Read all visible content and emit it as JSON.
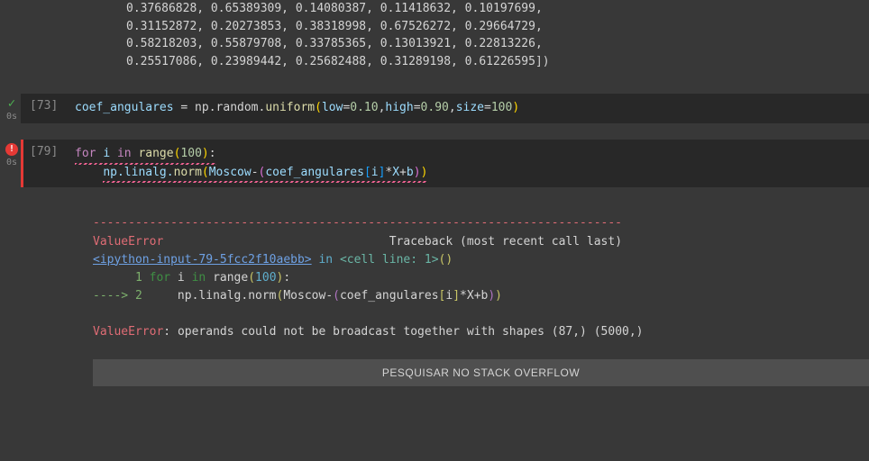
{
  "output_top": {
    "lines": [
      "0.37686828, 0.65389309, 0.14080387, 0.11418632, 0.10197699,",
      "0.31152872, 0.20273853, 0.38318998, 0.67526272, 0.29664729,",
      "0.58218203, 0.55879708, 0.33785365, 0.13013921, 0.22813226,",
      "0.25517086, 0.23989442, 0.25682488, 0.31289198, 0.61226595])"
    ]
  },
  "cell1": {
    "status": "ok",
    "exec_time": "0s",
    "exec_count": "[73]",
    "code": {
      "var": "coef_angulares",
      "assign": " = np.random.",
      "fn": "uniform",
      "p_low": "low",
      "v_low": "0.10",
      "p_high": "high",
      "v_high": "0.90",
      "p_size": "size",
      "v_size": "100"
    }
  },
  "cell2": {
    "status": "error",
    "exec_time": "0s",
    "exec_count": "[79]",
    "code": {
      "kw_for": "for",
      "var_i": "i",
      "kw_in": "in",
      "fn_range": "range",
      "range_arg": "100",
      "obj_np": "np.linalg.",
      "fn_norm": "norm",
      "arr_moscow": "Moscow",
      "arr_coef": "coef_angulares",
      "idx_i": "i",
      "var_x": "X",
      "var_b": "b"
    }
  },
  "traceback": {
    "dashes": "---------------------------------------------------------------------------",
    "err_name": "ValueError",
    "tb_header": "Traceback (most recent call last)",
    "link": "<ipython-input-79-5fcc2f10aebb>",
    "in": " in ",
    "cell_line": "<cell line: 1>",
    "parens": "()",
    "l1_num": "1",
    "l1_code_pre": " ",
    "l1_for": "for",
    "l1_i": " i ",
    "l1_in": "in",
    "l1_range": " range",
    "l1_range_arg": "100",
    "arrow": "----> ",
    "l2_num": "2",
    "l2_indent": "     np.linalg.norm",
    "l2_moscow": "Moscow",
    "l2_dash": "-",
    "l2_coef": "coef_angulares",
    "l2_i": "i",
    "l2_star": "*",
    "l2_x": "X",
    "l2_plus": "+",
    "l2_b": "b",
    "err_name2": "ValueError",
    "colon": ": ",
    "msg": "operands could not be broadcast together with shapes (87,) (5000,)"
  },
  "button": {
    "label": "PESQUISAR NO STACK OVERFLOW"
  }
}
